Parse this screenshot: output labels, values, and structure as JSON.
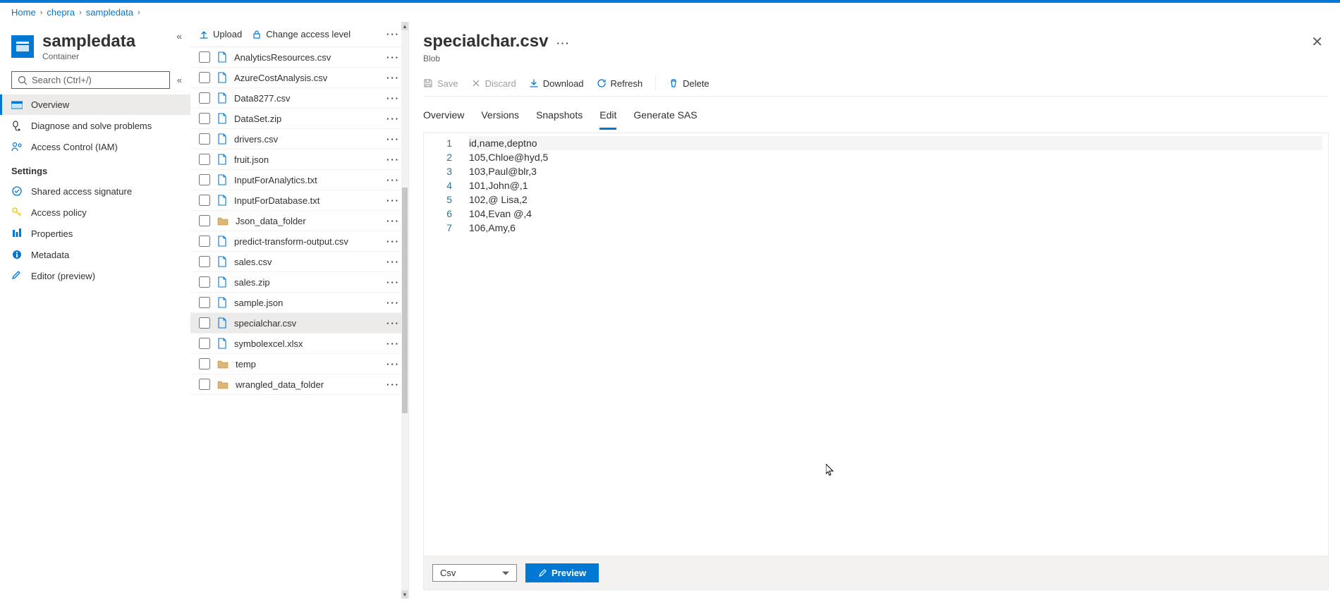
{
  "breadcrumb": [
    "Home",
    "chepra",
    "sampledata"
  ],
  "sidebar": {
    "title": "sampledata",
    "subtitle": "Container",
    "search_placeholder": "Search (Ctrl+/)",
    "nav": [
      {
        "icon": "overview",
        "label": "Overview",
        "selected": true
      },
      {
        "icon": "diagnose",
        "label": "Diagnose and solve problems"
      },
      {
        "icon": "iam",
        "label": "Access Control (IAM)"
      }
    ],
    "settings_label": "Settings",
    "settings": [
      {
        "icon": "sas",
        "label": "Shared access signature"
      },
      {
        "icon": "key",
        "label": "Access policy"
      },
      {
        "icon": "props",
        "label": "Properties"
      },
      {
        "icon": "meta",
        "label": "Metadata"
      },
      {
        "icon": "editor",
        "label": "Editor (preview)"
      }
    ]
  },
  "file_toolbar": {
    "upload": "Upload",
    "access": "Change access level"
  },
  "files": [
    {
      "name": "AnalyticsResources.csv",
      "type": "file"
    },
    {
      "name": "AzureCostAnalysis.csv",
      "type": "file"
    },
    {
      "name": "Data8277.csv",
      "type": "file"
    },
    {
      "name": "DataSet.zip",
      "type": "file"
    },
    {
      "name": "drivers.csv",
      "type": "file"
    },
    {
      "name": "fruit.json",
      "type": "file"
    },
    {
      "name": "InputForAnalytics.txt",
      "type": "file"
    },
    {
      "name": "InputForDatabase.txt",
      "type": "file"
    },
    {
      "name": "Json_data_folder",
      "type": "folder"
    },
    {
      "name": "predict-transform-output.csv",
      "type": "file"
    },
    {
      "name": "sales.csv",
      "type": "file"
    },
    {
      "name": "sales.zip",
      "type": "file"
    },
    {
      "name": "sample.json",
      "type": "file"
    },
    {
      "name": "specialchar.csv",
      "type": "file",
      "selected": true
    },
    {
      "name": "symbolexcel.xlsx",
      "type": "file"
    },
    {
      "name": "temp",
      "type": "folder"
    },
    {
      "name": "wrangled_data_folder",
      "type": "folder"
    }
  ],
  "detail": {
    "title": "specialchar.csv",
    "subtitle": "Blob",
    "toolbar": {
      "save": "Save",
      "discard": "Discard",
      "download": "Download",
      "refresh": "Refresh",
      "delete": "Delete"
    },
    "tabs": [
      "Overview",
      "Versions",
      "Snapshots",
      "Edit",
      "Generate SAS"
    ],
    "active_tab": "Edit",
    "editor_lines": [
      "id,name,deptno",
      "105,Chloe@hyd,5",
      "103,Paul@blr,3",
      "101,John@,1",
      "102,@ Lisa,2",
      "104,Evan @,4",
      "106,Amy,6"
    ],
    "format_select": "Csv",
    "preview_btn": "Preview"
  }
}
